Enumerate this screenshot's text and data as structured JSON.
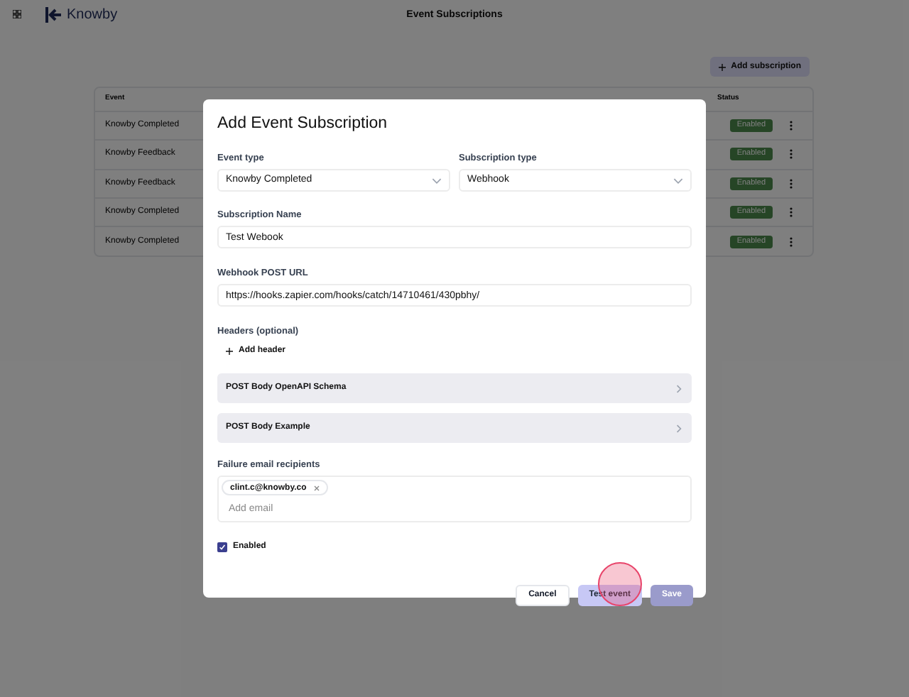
{
  "header": {
    "brand": "Knowby",
    "title": "Event Subscriptions"
  },
  "add_button": {
    "label": "Add subscription"
  },
  "table": {
    "columns": [
      "Event",
      "Status"
    ],
    "rows": [
      {
        "event": "Knowby Completed",
        "status": "Enabled"
      },
      {
        "event": "Knowby Feedback",
        "status": "Enabled"
      },
      {
        "event": "Knowby Feedback",
        "status": "Enabled"
      },
      {
        "event": "Knowby Completed",
        "status": "Enabled"
      },
      {
        "event": "Knowby Completed",
        "status": "Enabled"
      }
    ]
  },
  "dialog": {
    "title": "Add Event Subscription",
    "event_type": {
      "label": "Event type",
      "value": "Knowby Completed"
    },
    "subscription_type": {
      "label": "Subscription type",
      "value": "Webhook"
    },
    "name": {
      "label": "Subscription Name",
      "value": "Test Webook"
    },
    "url": {
      "label": "Webhook POST URL",
      "value": "https://hooks.zapier.com/hooks/catch/14710461/430pbhy/"
    },
    "headers": {
      "label": "Headers (optional)",
      "add": "Add header"
    },
    "sections": [
      {
        "label": "POST Body OpenAPI Schema",
        "expanded": false
      },
      {
        "label": "POST Body Example",
        "expanded": false
      }
    ],
    "recipients": {
      "label": "Failure email recipients",
      "chips": [
        "clint.c@knowby.co"
      ],
      "placeholder": "Add email"
    },
    "enabled": {
      "label": "Enabled",
      "checked": true
    },
    "buttons": [
      {
        "label": "Cancel",
        "kind": "outline"
      },
      {
        "label": "Test event",
        "kind": "secondary",
        "clicked": true
      },
      {
        "label": "Save",
        "kind": "primary"
      }
    ]
  }
}
